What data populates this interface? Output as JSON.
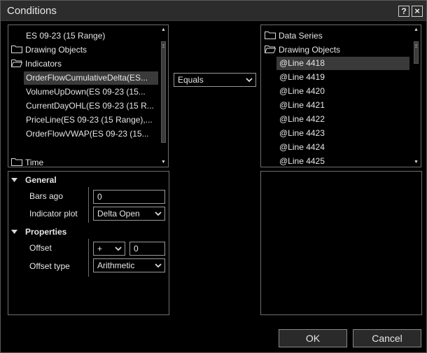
{
  "window": {
    "title": "Conditions",
    "help_label": "?",
    "close_label": "×"
  },
  "left_tree": {
    "items": [
      {
        "label": "ES 09-23 (15 Range)",
        "folder": false,
        "selected": false
      },
      {
        "label": "Drawing Objects",
        "folder": true,
        "selected": false
      },
      {
        "label": "Indicators",
        "folder": true,
        "selected": false
      },
      {
        "label": "OrderFlowCumulativeDelta(ES...",
        "folder": false,
        "selected": true
      },
      {
        "label": "VolumeUpDown(ES 09-23 (15...",
        "folder": false,
        "selected": false
      },
      {
        "label": "CurrentDayOHL(ES 09-23 (15 R...",
        "folder": false,
        "selected": false
      },
      {
        "label": "PriceLine(ES 09-23 (15 Range),...",
        "folder": false,
        "selected": false
      },
      {
        "label": "OrderFlowVWAP(ES 09-23 (15...",
        "folder": false,
        "selected": false
      }
    ],
    "time_label": "Time"
  },
  "operator": {
    "selected": "Equals"
  },
  "right_tree": {
    "folders": [
      "Data Series",
      "Drawing Objects"
    ],
    "items": [
      {
        "label": "@Line 4418",
        "selected": true
      },
      {
        "label": "@Line 4419",
        "selected": false
      },
      {
        "label": "@Line 4420",
        "selected": false
      },
      {
        "label": "@Line 4421",
        "selected": false
      },
      {
        "label": "@Line 4422",
        "selected": false
      },
      {
        "label": "@Line 4423",
        "selected": false
      },
      {
        "label": "@Line 4424",
        "selected": false
      },
      {
        "label": "@Line 4425",
        "selected": false
      }
    ]
  },
  "properties": {
    "general": {
      "title": "General",
      "bars_ago_label": "Bars ago",
      "bars_ago_value": "0",
      "indicator_plot_label": "Indicator plot",
      "indicator_plot_value": "Delta Open"
    },
    "props": {
      "title": "Properties",
      "offset_label": "Offset",
      "offset_sign": "+",
      "offset_value": "0",
      "offset_type_label": "Offset type",
      "offset_type_value": "Arithmetic"
    }
  },
  "footer": {
    "ok_label": "OK",
    "cancel_label": "Cancel"
  }
}
